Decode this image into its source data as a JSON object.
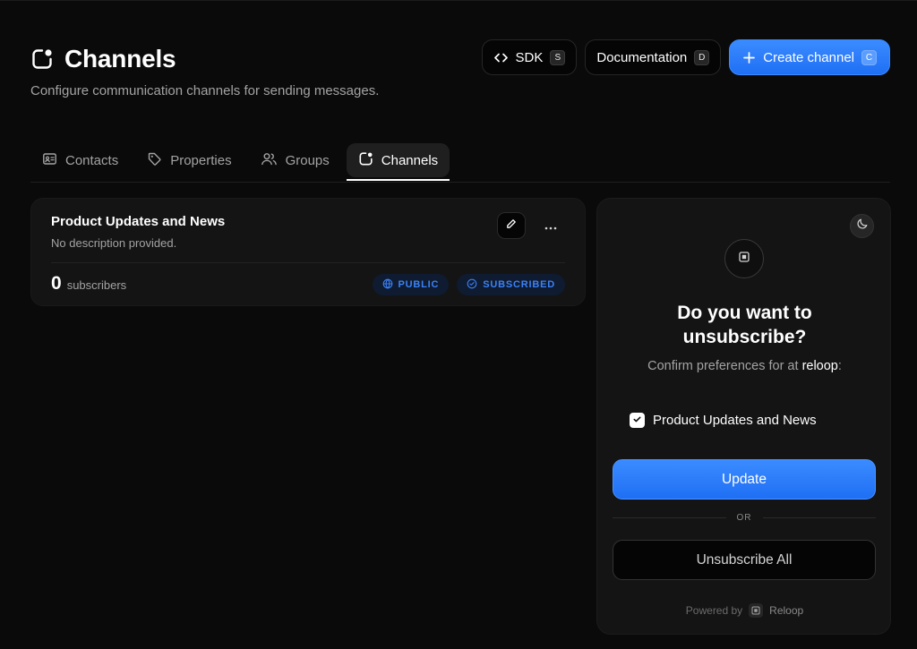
{
  "header": {
    "title": "Channels",
    "subtitle": "Configure communication channels for sending messages.",
    "actions": {
      "sdk": {
        "label": "SDK",
        "shortcut": "S"
      },
      "docs": {
        "label": "Documentation",
        "shortcut": "D"
      },
      "create": {
        "label": "Create channel",
        "shortcut": "C"
      }
    }
  },
  "tabs": [
    {
      "label": "Contacts",
      "icon": "contact-card-icon",
      "active": false
    },
    {
      "label": "Properties",
      "icon": "tag-icon",
      "active": false
    },
    {
      "label": "Groups",
      "icon": "users-icon",
      "active": false
    },
    {
      "label": "Channels",
      "icon": "channel-icon",
      "active": true
    }
  ],
  "channel": {
    "name": "Product Updates and News",
    "description": "No description provided.",
    "subscriber_count": "0",
    "subscriber_label": "subscribers",
    "badges": {
      "visibility": "PUBLIC",
      "status": "SUBSCRIBED"
    }
  },
  "preview": {
    "heading": "Do you want to unsubscribe?",
    "confirm_prefix": "Confirm preferences for at ",
    "confirm_brand": "reloop",
    "confirm_suffix": ":",
    "channel_option": {
      "label": "Product Updates and News",
      "checked": true
    },
    "update_label": "Update",
    "or_label": "OR",
    "unsubscribe_all_label": "Unsubscribe All",
    "powered_by": "Powered by",
    "brand_name": "Reloop"
  },
  "colors": {
    "background": "#0a0a0a",
    "accent": "#2f80ff",
    "badge_text": "#3b82f6"
  }
}
